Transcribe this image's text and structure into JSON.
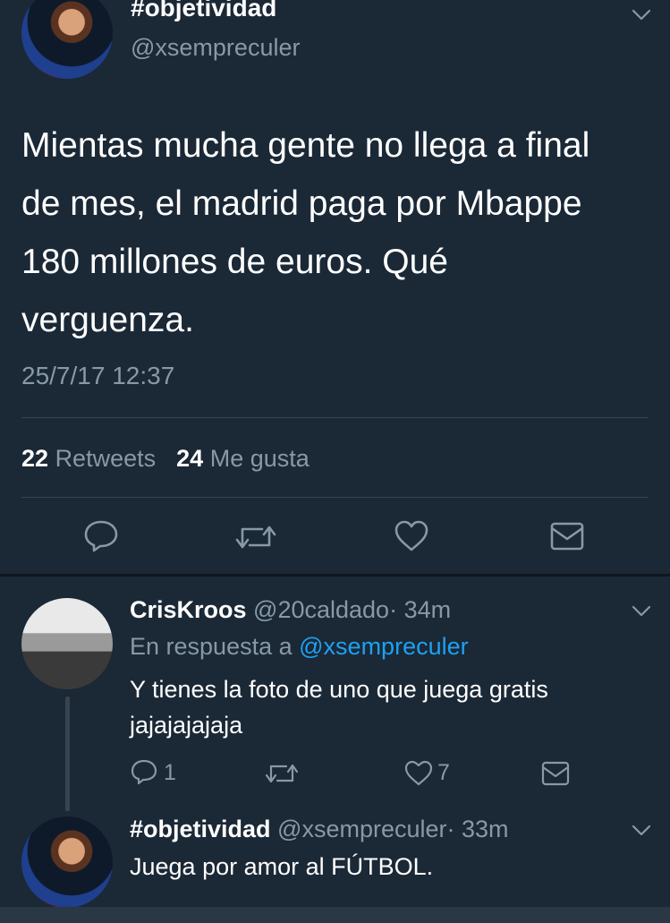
{
  "main_tweet": {
    "display_name": "#objetividad",
    "handle": "@xsempreculer",
    "text_lines": [
      "Mientas mucha gente no llega a final",
      "de mes, el madrid paga por Mbappe",
      "180 millones de euros. Qué",
      "verguenza."
    ],
    "timestamp": "25/7/17 12:37",
    "retweets_count": "22",
    "retweets_label": "Retweets",
    "likes_count": "24",
    "likes_label": "Me gusta"
  },
  "replies": [
    {
      "display_name": "CrisKroos",
      "handle": "@20caldado",
      "time": "· 34m",
      "reply_prefix": "En respuesta a",
      "reply_to": "@xsempreculer",
      "text_lines": [
        "Y tienes la foto de uno que juega gratis",
        "jajajajajaja"
      ],
      "reply_count": "1",
      "like_count": "7"
    },
    {
      "display_name": "#objetividad",
      "handle": "@xsempreculer",
      "time": "· 33m",
      "text_lines": [
        "Juega por amor al FÚTBOL."
      ]
    }
  ],
  "icons": [
    "chevron-down",
    "reply",
    "retweet",
    "like",
    "message"
  ],
  "colors": {
    "background": "#1b2836",
    "muted": "#8899a6",
    "link": "#1da1f2",
    "divider": "#38444d"
  }
}
